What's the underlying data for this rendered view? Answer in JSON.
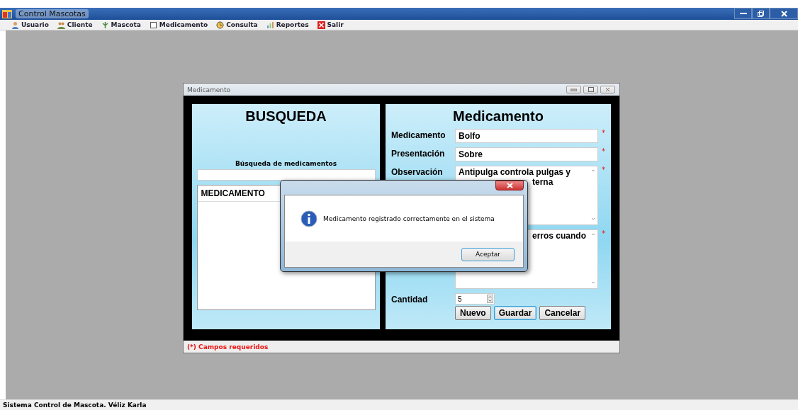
{
  "window": {
    "title": "Control Mascotas"
  },
  "menu": [
    {
      "label": "Usuario",
      "kind": "user"
    },
    {
      "label": "Cliente",
      "kind": "people"
    },
    {
      "label": "Mascota",
      "kind": "paw"
    },
    {
      "label": "Medicamento",
      "kind": "box"
    },
    {
      "label": "Consulta",
      "kind": "clock"
    },
    {
      "label": "Reportes",
      "kind": "chart"
    },
    {
      "label": "Salir",
      "kind": "exit"
    }
  ],
  "child_window": {
    "title": "Medicamento",
    "search_panel": {
      "heading": "BUSQUEDA",
      "search_label": "Búsqueda de medicamentos",
      "list_column": "MEDICAMENTO"
    },
    "form_panel": {
      "heading": "Medicamento",
      "fields": [
        {
          "kind": "text",
          "label": "Medicamento",
          "value": "Bolfo",
          "required_mark": "*"
        },
        {
          "kind": "text",
          "label": "Presentación",
          "value": "Sobre",
          "required_mark": "*"
        },
        {
          "kind": "memo",
          "label": "Observación",
          "lines": [
            "Antipulga controla pulgas y",
            "terna"
          ],
          "required_mark": "*"
        },
        {
          "kind": "memo",
          "lines": [
            "erros cuando"
          ],
          "required_mark": "*"
        },
        {
          "kind": "spin",
          "label": "Cantidad",
          "value": "5"
        }
      ],
      "buttons": [
        {
          "label": "Nuevo",
          "focused": false
        },
        {
          "label": "Guardar",
          "focused": true
        },
        {
          "label": "Cancelar",
          "focused": false
        }
      ]
    },
    "footer": "(*) Campos requeridos"
  },
  "dialog": {
    "message": "Medicamento registrado correctamente en el sistema",
    "button": "Aceptar"
  },
  "status_bar": "Sistema Control de Mascota. Véliz Karla"
}
